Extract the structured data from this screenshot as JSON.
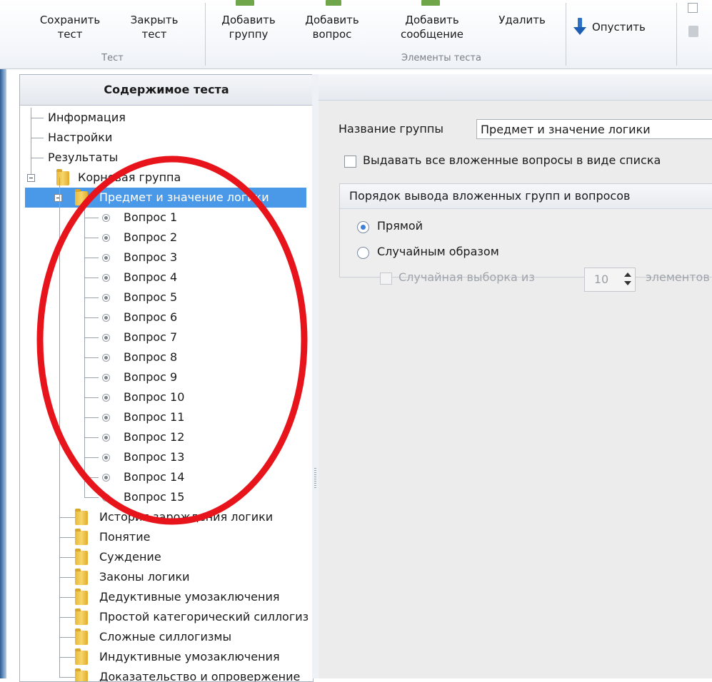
{
  "ribbon": {
    "buttons": {
      "save_test": {
        "line1": "Сохранить",
        "line2": "тест"
      },
      "close_test": {
        "line1": "Закрыть",
        "line2": "тест"
      },
      "add_group": {
        "line1": "Добавить",
        "line2": "группу"
      },
      "add_question": {
        "line1": "Добавить",
        "line2": "вопрос"
      },
      "add_message": {
        "line1": "Добавить",
        "line2": "сообщение"
      },
      "delete": {
        "line1": "Удалить"
      },
      "lower": {
        "label": "Опустить"
      }
    },
    "groups": {
      "test": "Тест",
      "elements": "Элементы теста"
    }
  },
  "tree": {
    "header": "Содержимое теста",
    "top_items": [
      "Информация",
      "Настройки",
      "Результаты"
    ],
    "root_group": "Корневая группа",
    "selected_group": "Предмет и значение логики",
    "questions": [
      "Вопрос 1",
      "Вопрос 2",
      "Вопрос 3",
      "Вопрос 4",
      "Вопрос 5",
      "Вопрос 6",
      "Вопрос 7",
      "Вопрос 8",
      "Вопрос 9",
      "Вопрос 10",
      "Вопрос 11",
      "Вопрос 12",
      "Вопрос 13",
      "Вопрос 14",
      "Вопрос 15"
    ],
    "other_groups": [
      "История зарождения логики",
      "Понятие",
      "Суждение",
      "Законы логики",
      "Дедуктивные умозаключения",
      "Простой категорический силлогизм",
      "Сложные силлогизмы",
      "Индуктивные умозаключения",
      "Доказательство и опровержение"
    ]
  },
  "details": {
    "group_name_label": "Название группы",
    "group_name_value": "Предмет и значение логики",
    "list_checkbox_label": "Выдавать все вложенные вопросы в виде списка",
    "order_heading": "Порядок вывода вложенных групп и вопросов",
    "order_direct": "Прямой",
    "order_random": "Случайным образом",
    "random_sample_label": "Случайная выборка из",
    "random_sample_value": "10",
    "random_sample_suffix": "элементов"
  },
  "colors": {
    "selection": "#4a98e8",
    "annotation": "#e8141b"
  }
}
